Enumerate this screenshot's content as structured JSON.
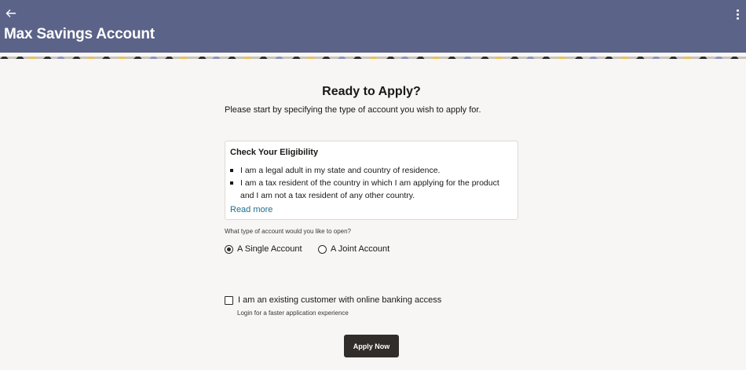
{
  "header": {
    "title": "Max Savings Account",
    "back_icon": "arrow-left-icon",
    "menu_icon": "kebab-menu-icon",
    "bg_color": "#5c6388"
  },
  "main": {
    "heading": "Ready to Apply?",
    "intro": "Please start by specifying the type of account you wish to apply for."
  },
  "eligibility": {
    "title": "Check Your Eligibility",
    "items": [
      "I am a legal adult in my state and country of residence.",
      "I am a tax resident of the country in which I am applying for the product and I am not a tax resident of any other country."
    ],
    "read_more": "Read more",
    "link_color": "#1f6f8b"
  },
  "account_type": {
    "question": "What type of account would you like to open?",
    "options": [
      {
        "label": "A Single Account",
        "selected": true
      },
      {
        "label": "A Joint Account",
        "selected": false
      }
    ]
  },
  "existing_customer": {
    "label": "I am an existing customer with online banking access",
    "sublabel": "Login for a faster application experience",
    "checked": false
  },
  "apply_button": {
    "label": "Apply Now",
    "color": "#312d2a"
  }
}
